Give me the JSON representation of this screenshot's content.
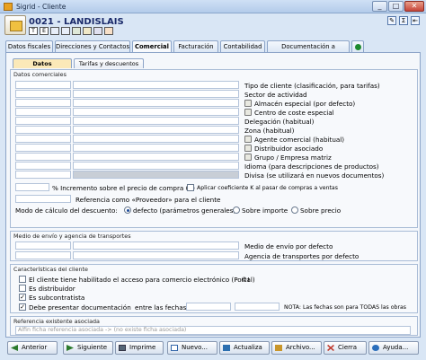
{
  "window": {
    "title": "Sigrid - Cliente",
    "min": "_",
    "max": "□",
    "close": "✕"
  },
  "header": {
    "client": "0021 - LANDISLAIS",
    "toolbar_letters": [
      "T",
      "E"
    ],
    "right_icons": [
      "edit-icon",
      "sigma-icon",
      "pin-icon"
    ]
  },
  "tabs": [
    {
      "label": "Datos fiscales"
    },
    {
      "label": "Direcciones y Contactos"
    },
    {
      "label": "Comercial",
      "active": true
    },
    {
      "label": "Facturación"
    },
    {
      "label": "Contabilidad"
    },
    {
      "label": "Documentación a presentar"
    }
  ],
  "subtabs": [
    {
      "label": "Datos comerciales",
      "active": true
    },
    {
      "label": "Tarifas y descuentos"
    }
  ],
  "datos": {
    "group_title": "Datos comerciales",
    "fields": [
      {
        "label": "Tipo de cliente (clasificación, para tarifas)",
        "icon": false
      },
      {
        "label": "Sector de actividad",
        "icon": false
      },
      {
        "label": "Almacén especial (por defecto)",
        "icon": true
      },
      {
        "label": "Centro de coste especial",
        "icon": true
      },
      {
        "label": "Delegación (habitual)",
        "icon": false
      },
      {
        "label": "Zona (habitual)",
        "icon": false
      },
      {
        "label": "Agente comercial (habitual)",
        "icon": true
      },
      {
        "label": "Distribuidor asociado",
        "icon": true
      },
      {
        "label": "Grupo / Empresa matriz",
        "icon": true
      },
      {
        "label": "Idioma (para descripciones de productos)",
        "icon": false
      },
      {
        "label": "Divisa (se utilizará en nuevos documentos)",
        "icon": false
      }
    ],
    "incremento_label": "% Incremento sobre el precio de compra (K)",
    "aplicar_label": "Aplicar coeficiente K al pasar de compras a ventas",
    "referencia_label": "Referencia como «Proveedor» para el cliente",
    "modo_label": "Modo de cálculo del descuento:",
    "modo_options": [
      {
        "label": "defecto (parámetros generales)",
        "selected": true
      },
      {
        "label": "Sobre importe",
        "selected": false
      },
      {
        "label": "Sobre precio",
        "selected": false
      }
    ]
  },
  "envio": {
    "group_title": "Medio de envío y agencia de transportes",
    "fields": [
      "Medio de envío por defecto",
      "Agencia de transportes por defecto"
    ]
  },
  "caracteristicas": {
    "group_title": "Características del cliente",
    "checks": [
      {
        "label": "El cliente tiene habilitado el acceso para comercio electrónico (Portal)",
        "checked": false
      },
      {
        "label": "Es distribuidor",
        "checked": false
      },
      {
        "label": "Es subcontratista",
        "checked": true
      },
      {
        "label": "Debe presentar documentación",
        "checked": true
      }
    ],
    "portal_code": "©I",
    "entre_label": "entre las fechas",
    "nota": "NOTA: Las fechas son para TODAS las obras"
  },
  "referencia": {
    "group_title": "Referencia existente asociada",
    "placeholder": "Alfin ficha referencia asociada ->  (no existe ficha asociada)"
  },
  "buttons": [
    {
      "label": "Anterior",
      "icon": "arrow-left-icon",
      "color": "#2c7a2c"
    },
    {
      "label": "Siguiente",
      "icon": "arrow-right-icon",
      "color": "#2c7a2c"
    },
    {
      "label": "Imprime",
      "icon": "printer-icon",
      "color": "#556677"
    },
    {
      "label": "Nuevo...",
      "icon": "new-icon",
      "color": "#3366aa"
    },
    {
      "label": "Actualiza",
      "icon": "save-icon",
      "color": "#2c6fb0"
    },
    {
      "label": "Archivo...",
      "icon": "folder-icon",
      "color": "#c9962a"
    },
    {
      "label": "Cierra",
      "icon": "close-icon",
      "color": "#c0392b"
    },
    {
      "label": "Ayuda...",
      "icon": "help-icon",
      "color": "#2a6ebb"
    }
  ]
}
